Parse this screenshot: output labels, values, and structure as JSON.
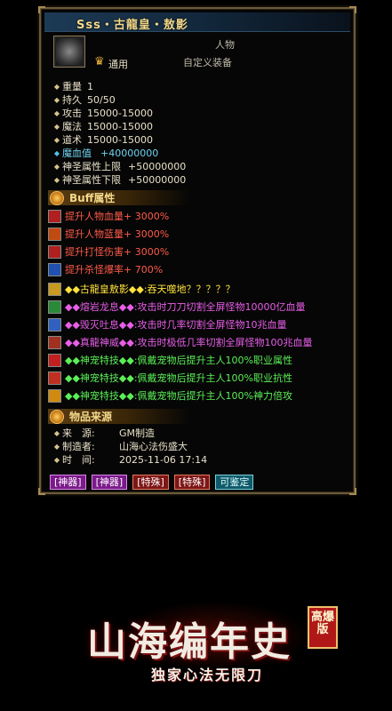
{
  "title": "Sss・古龍皇・敖影",
  "header": {
    "slot": "人物",
    "rarity": "通用",
    "type": "自定义装备"
  },
  "stats": [
    {
      "label": "重量",
      "value": "1"
    },
    {
      "label": "持久",
      "value": "50/50"
    },
    {
      "label": "攻击",
      "value": "15000-15000"
    },
    {
      "label": "魔法",
      "value": "15000-15000"
    },
    {
      "label": "道术",
      "value": "15000-15000"
    },
    {
      "label": "魔血值",
      "value": "+40000000",
      "highlight": true
    },
    {
      "label": "神圣属性上限",
      "value": "+50000000"
    },
    {
      "label": "神圣属性下限",
      "value": "+50000000"
    }
  ],
  "buff_section": {
    "title": "Buff属性"
  },
  "buffs": [
    {
      "text": "提升人物血量+ 3000%"
    },
    {
      "text": "提升人物蓝量+ 3000%"
    },
    {
      "text": "提升打怪伤害+ 3000%"
    },
    {
      "text": "提升杀怪爆率+ 700%"
    }
  ],
  "effects": [
    {
      "name": "◆◆古龍皇敖影◆◆:",
      "desc": "吞天噬地？？？？？",
      "color": "yellow"
    },
    {
      "name": "◆◆熔岩龙息◆◆:",
      "desc": "攻击时刀刀切割全屏怪物10000亿血量",
      "color": "magenta"
    },
    {
      "name": "◆◆毁灭吐息◆◆:",
      "desc": "攻击时几率切割全屏怪物10兆血量",
      "color": "magenta"
    },
    {
      "name": "◆◆真龍神威◆◆:",
      "desc": "攻击时极低几率切割全屏怪物100兆血量",
      "color": "magenta"
    },
    {
      "name": "◆◆神宠特技◆◆:",
      "desc": "佩戴宠物后提升主人100%职业属性",
      "color": "green"
    },
    {
      "name": "◆◆神宠特技◆◆:",
      "desc": "佩戴宠物后提升主人100%职业抗性",
      "color": "green"
    },
    {
      "name": "◆◆神宠特技◆◆:",
      "desc": "佩戴宠物后提升主人100%神力倍攻",
      "color": "green"
    }
  ],
  "source_section": {
    "title": "物品来源"
  },
  "source": [
    {
      "label": "来　源:",
      "value": "GM制造"
    },
    {
      "label": "制造者:",
      "value": "山海心法伤盛大"
    },
    {
      "label": "时　间:",
      "value": "2025-11-06 17:14"
    }
  ],
  "tags": [
    {
      "label": "[神器]",
      "style": "purple"
    },
    {
      "label": "[神器]",
      "style": "purple"
    },
    {
      "label": "[特殊]",
      "style": "red"
    },
    {
      "label": "[特殊]",
      "style": "red"
    },
    {
      "label": "可鉴定",
      "style": "teal"
    }
  ],
  "banner": {
    "title": "山海编年史",
    "badge": "高爆版",
    "subtitle": "独家心法无限刀"
  }
}
